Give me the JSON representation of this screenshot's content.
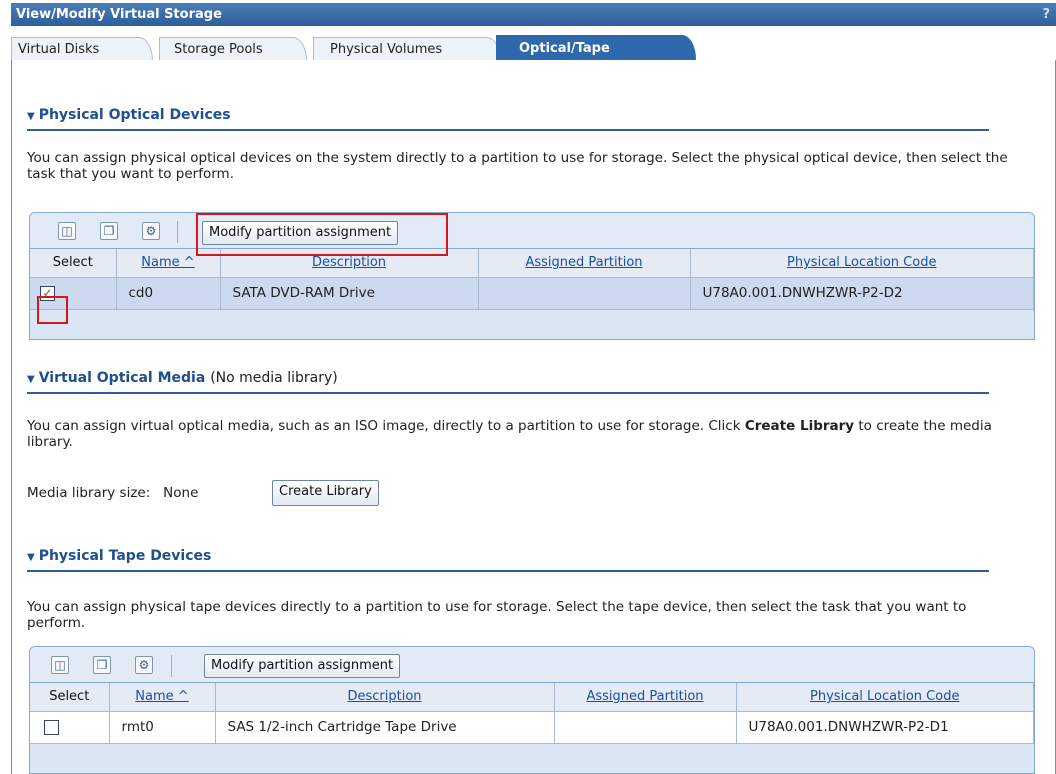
{
  "window": {
    "title": "View/Modify Virtual Storage",
    "help_glyph": "?"
  },
  "tabs": [
    {
      "label": "Virtual Disks",
      "active": false
    },
    {
      "label": "Storage Pools",
      "active": false
    },
    {
      "label": "Physical Volumes",
      "active": false
    },
    {
      "label": "Optical/Tape",
      "active": true
    }
  ],
  "optical": {
    "heading": "Physical Optical Devices",
    "description": "You can assign physical optical devices on the system directly to a partition to use for storage. Select the physical optical device, then select the task that you want to perform.",
    "toolbar": {
      "modify_label": "Modify partition assignment"
    },
    "columns": [
      "Select",
      "Name ^",
      "Description",
      "Assigned Partition",
      "Physical Location Code"
    ],
    "rows": [
      {
        "selected": true,
        "name": "cd0",
        "description": "SATA DVD-RAM Drive",
        "assigned_partition": "",
        "location_code": "U78A0.001.DNWHZWR-P2-D2"
      }
    ]
  },
  "virtual_media": {
    "heading": "Virtual Optical Media",
    "heading_note": "(No media library)",
    "description_pre": "You can assign virtual optical media, such as an ISO image, directly to a partition to use for storage. Click ",
    "description_bold": "Create Library",
    "description_post": " to create the media library.",
    "size_label": "Media library size:",
    "size_value": "None",
    "create_label": "Create Library"
  },
  "tape": {
    "heading": "Physical Tape Devices",
    "description": "You can assign physical tape devices directly to a partition to use for storage. Select the tape device, then select the task that you want to perform.",
    "toolbar": {
      "modify_label": "Modify partition assignment"
    },
    "columns": [
      "Select",
      "Name ^",
      "Description",
      "Assigned Partition",
      "Physical Location Code"
    ],
    "rows": [
      {
        "selected": false,
        "name": "rmt0",
        "description": "SAS 1/2-inch Cartridge Tape Drive",
        "assigned_partition": "",
        "location_code": "U78A0.001.DNWHZWR-P2-D1"
      }
    ]
  },
  "colors": {
    "title_bar": "#3c6da8",
    "active_tab": "#2f69ad",
    "selected_row": "#cdd9ef",
    "highlight": "#d8141c"
  }
}
